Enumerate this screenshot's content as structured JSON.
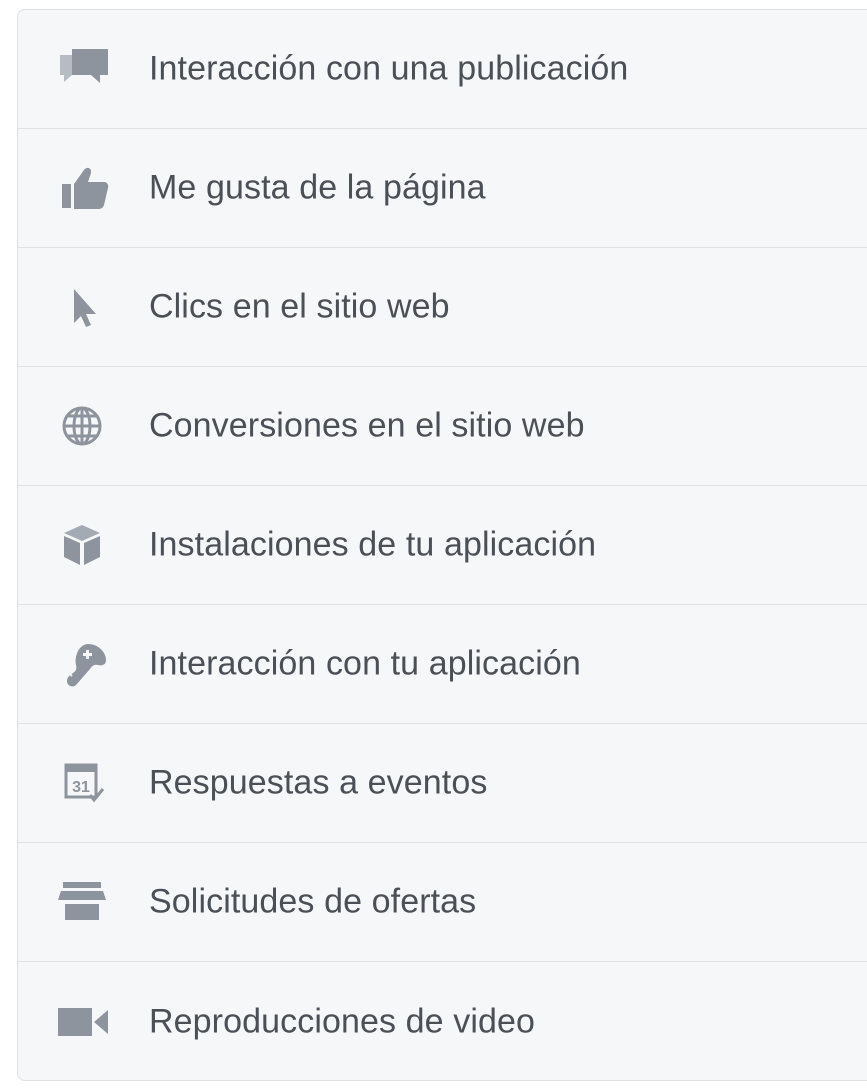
{
  "menu": {
    "items": [
      {
        "label": "Interacción con una publicación",
        "icon": "post-engagement-icon"
      },
      {
        "label": "Me gusta de la página",
        "icon": "thumbs-up-icon"
      },
      {
        "label": "Clics en el sitio web",
        "icon": "cursor-icon"
      },
      {
        "label": "Conversiones en el sitio web",
        "icon": "globe-icon"
      },
      {
        "label": "Instalaciones de tu aplicación",
        "icon": "cube-icon"
      },
      {
        "label": "Interacción con tu aplicación",
        "icon": "gamepad-icon"
      },
      {
        "label": "Respuestas a eventos",
        "icon": "calendar-icon"
      },
      {
        "label": "Solicitudes de ofertas",
        "icon": "storefront-icon"
      },
      {
        "label": "Reproducciones de video",
        "icon": "video-camera-icon"
      }
    ]
  },
  "colors": {
    "panel_background": "#f6f7f9",
    "divider": "#dfe1e5",
    "text": "#4b4f56",
    "icon": "#8d949e"
  }
}
